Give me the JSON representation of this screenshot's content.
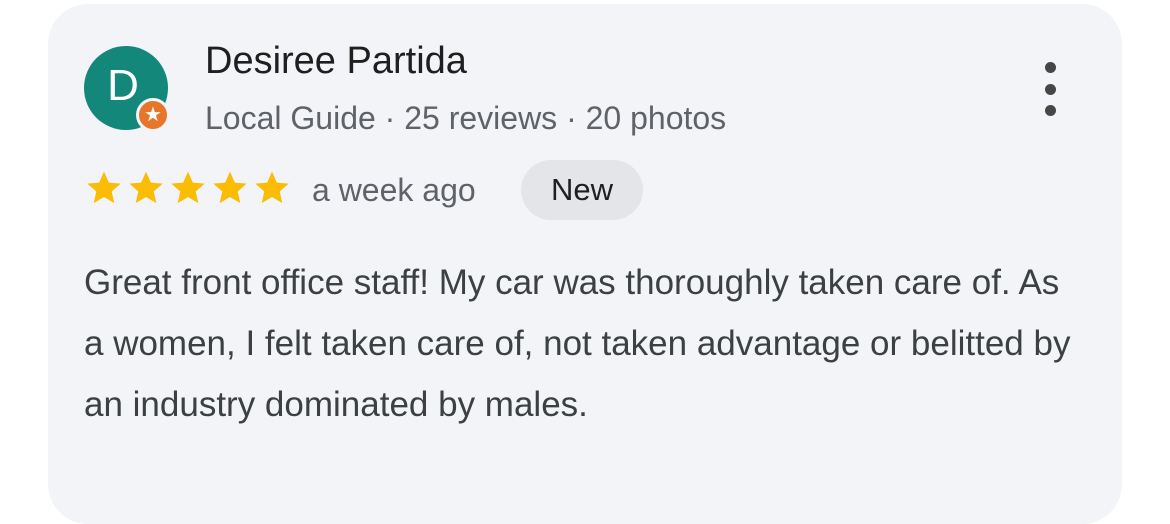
{
  "review": {
    "avatar_initial": "D",
    "reviewer_name": "Desiree Partida",
    "reviewer_meta": "Local Guide · 25 reviews · 20 photos",
    "rating": 5,
    "rating_max": 5,
    "time_ago": "a week ago",
    "badge": "New",
    "text": "Great front office staff! My car was thoroughly taken care of. As a women, I felt taken care of, not taken advantage or belitted by an industry dominated by males."
  },
  "icons": {
    "menu": "more-vert-icon",
    "star": "star-icon",
    "local_guide": "local-guide-badge-icon"
  },
  "colors": {
    "avatar_bg": "#13877a",
    "guide_badge": "#e8762a",
    "star": "#fbbc04",
    "card_bg": "#f2f4f7",
    "chip_bg": "#e3e5e8"
  }
}
